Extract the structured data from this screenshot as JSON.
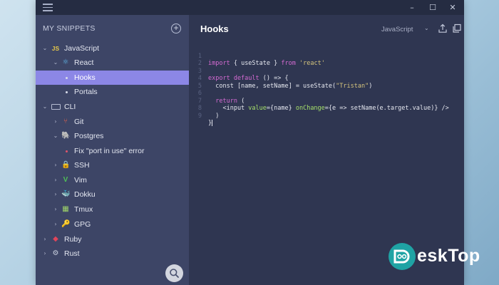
{
  "titlebar": {
    "minimize": "–",
    "maximize": "☐",
    "close": "✕"
  },
  "sidebar": {
    "header": "MY SNIPPETS",
    "add_label": "+",
    "items": [
      {
        "label": "JavaScript",
        "icon": "JS",
        "chevron": "⌄"
      },
      {
        "label": "React",
        "icon": "⚛",
        "chevron": "⌄"
      },
      {
        "label": "Hooks"
      },
      {
        "label": "Portals"
      },
      {
        "label": "CLI",
        "chevron": "⌄"
      },
      {
        "label": "Git",
        "icon": "⑂",
        "chevron": "›"
      },
      {
        "label": "Postgres",
        "icon": "🐘",
        "chevron": "⌄"
      },
      {
        "label": "Fix \"port in use\" error"
      },
      {
        "label": "SSH",
        "icon": "🔒",
        "chevron": "›"
      },
      {
        "label": "Vim",
        "icon": "V",
        "chevron": "›"
      },
      {
        "label": "Dokku",
        "icon": "🐳",
        "chevron": "›"
      },
      {
        "label": "Tmux",
        "icon": "▦",
        "chevron": "›"
      },
      {
        "label": "GPG",
        "icon": "🔑",
        "chevron": "›"
      },
      {
        "label": "Ruby",
        "icon": "◆",
        "chevron": "›"
      },
      {
        "label": "Rust",
        "icon": "⚙",
        "chevron": "›"
      }
    ]
  },
  "editor": {
    "title": "Hooks",
    "language": "JavaScript",
    "language_chevron": "⌄",
    "line_numbers": [
      "1",
      "2",
      "3",
      "4",
      "5",
      "6",
      "7",
      "8",
      "9"
    ],
    "code": {
      "l1_kw1": "import",
      "l1_mid": " { useState } ",
      "l1_kw2": "from",
      "l1_sp": " ",
      "l1_str": "'react'",
      "l3_kw": "export default",
      "l3_rest": " () => {",
      "l4": "  const [name, setName] = useState(",
      "l4_str": "\"Tristan\"",
      "l4_end": ")",
      "l6_kw": "  return",
      "l6_rest": " (",
      "l7_a": "    <input ",
      "l7_attr1": "value",
      "l7_b": "={name} ",
      "l7_attr2": "onChange",
      "l7_c": "={e => setName(e.target.value)} />",
      "l8": "  )",
      "l9": "}"
    }
  },
  "watermark": {
    "text": "eskTop"
  },
  "colors": {
    "accent": "#8c87e6",
    "sidebar_bg": "#3d4566",
    "editor_bg": "#2f3651",
    "keyword": "#d46ad2",
    "string": "#d6c57d",
    "attribute": "#a6e06a"
  }
}
